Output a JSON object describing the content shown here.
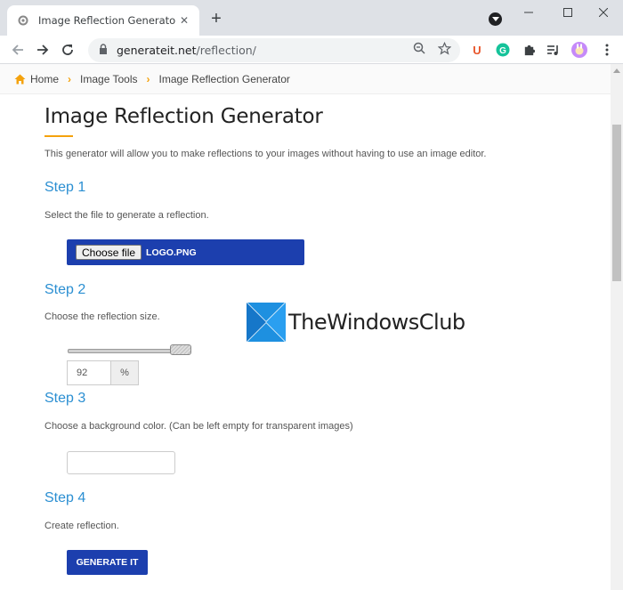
{
  "browser": {
    "tab_title": "Image Reflection Generator by G",
    "url_host": "generateit.net",
    "url_path": "/reflection/",
    "colors": {
      "tabstrip": "#dee1e6",
      "accent_blue": "#1c3fae"
    }
  },
  "breadcrumb": {
    "items": [
      "Home",
      "Image Tools",
      "Image Reflection Generator"
    ]
  },
  "page": {
    "title": "Image Reflection Generator",
    "intro": "This generator will allow you to make reflections to your images without having to use an image editor."
  },
  "steps": [
    {
      "title": "Step 1",
      "desc": "Select the file to generate a reflection."
    },
    {
      "title": "Step 2",
      "desc": "Choose the reflection size."
    },
    {
      "title": "Step 3",
      "desc": "Choose a background color. (Can be left empty for transparent images)"
    },
    {
      "title": "Step 4",
      "desc": "Create reflection."
    }
  ],
  "file_input": {
    "button_label": "Choose file",
    "file_name": "LOGO.PNG"
  },
  "reflection_size": {
    "value": "92",
    "unit": "%",
    "slider_fraction": 0.92
  },
  "background_color": {
    "value": ""
  },
  "generate_button": "GENERATE IT",
  "watermark": {
    "text": "TheWindowsClub"
  }
}
